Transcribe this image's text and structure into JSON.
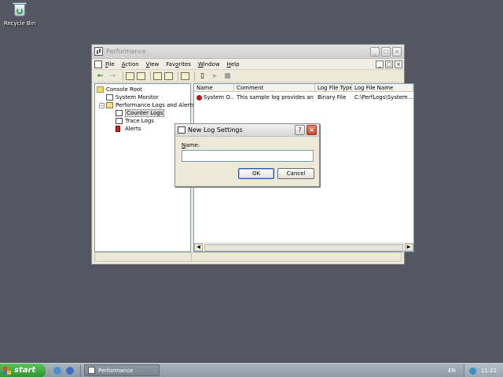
{
  "desktop": {
    "recycle_bin": "Recycle Bin"
  },
  "window": {
    "title": "Performance",
    "controls": {
      "minimize": "_",
      "maximize": "□",
      "close": "×"
    },
    "menu": [
      "File",
      "Action",
      "View",
      "Favorites",
      "Window",
      "Help"
    ],
    "menu_accel": [
      "F",
      "A",
      "V",
      "o",
      "W",
      "H"
    ],
    "tree": {
      "root": "Console Root",
      "system_monitor": "System Monitor",
      "perf_logs": "Performance Logs and Alerts",
      "counter_logs": "Counter Logs",
      "trace_logs": "Trace Logs",
      "alerts": "Alerts"
    },
    "list": {
      "columns": [
        "Name",
        "Comment",
        "Log File Type",
        "Log File Name"
      ],
      "rows": [
        {
          "name": "System O...",
          "comment": "This sample log provides an o...",
          "type": "Binary File",
          "file": "C:\\PerfLogs\\System..."
        }
      ]
    }
  },
  "dialog": {
    "title": "New Log Settings",
    "help": "?",
    "close": "×",
    "name_label": "Name:",
    "name_accel": "N",
    "name_value": "",
    "ok": "OK",
    "cancel": "Cancel"
  },
  "taskbar": {
    "start": "start",
    "task": "Performance",
    "lang": "EN",
    "clock": "11:22"
  }
}
